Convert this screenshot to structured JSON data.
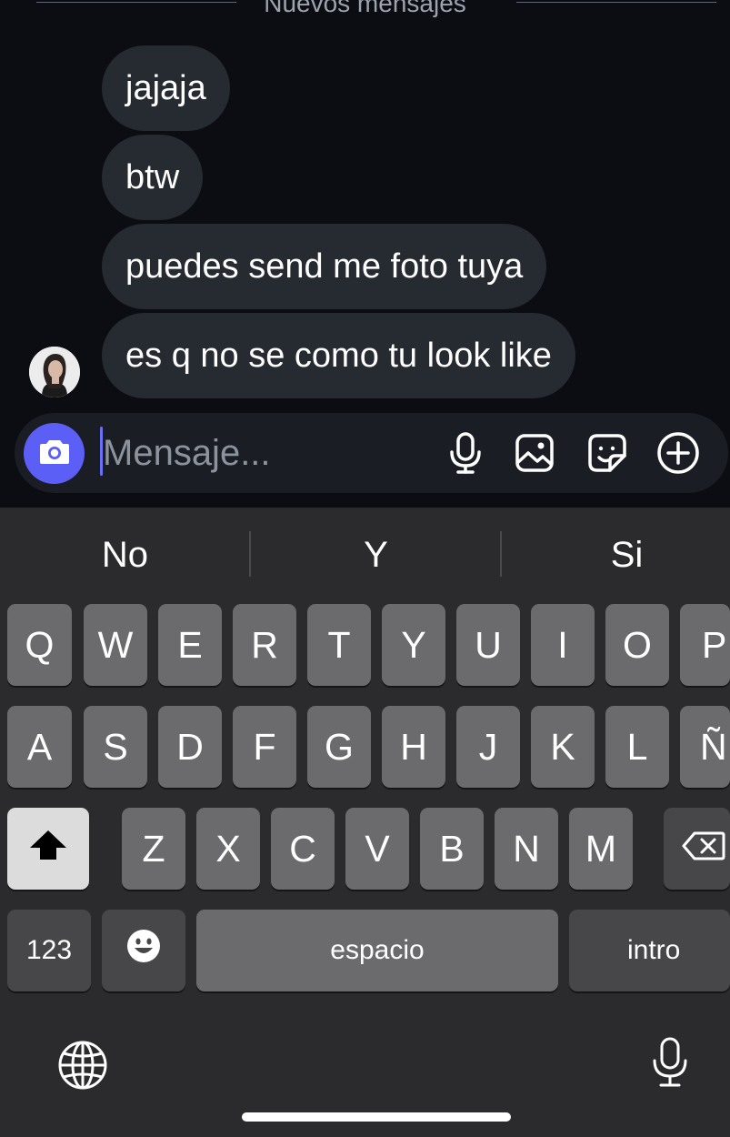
{
  "chat": {
    "divider": "Nuevos mensajes",
    "messages": [
      {
        "text": "jajaja"
      },
      {
        "text": "btw"
      },
      {
        "text": "puedes send me foto tuya"
      },
      {
        "text": "es q no se como tu look like"
      }
    ]
  },
  "composer": {
    "placeholder": "Mensaje...",
    "camera_icon": "camera-icon",
    "icons": [
      "microphone-icon",
      "gallery-icon",
      "sticker-icon",
      "add-icon"
    ],
    "accent": "#5b5ff5"
  },
  "keyboard": {
    "suggestions": [
      "No",
      "Y",
      "Si"
    ],
    "row1": [
      "Q",
      "W",
      "E",
      "R",
      "T",
      "Y",
      "U",
      "I",
      "O",
      "P"
    ],
    "row2": [
      "A",
      "S",
      "D",
      "F",
      "G",
      "H",
      "J",
      "K",
      "L",
      "Ñ"
    ],
    "row3": [
      "Z",
      "X",
      "C",
      "V",
      "B",
      "N",
      "M"
    ],
    "numbers_label": "123",
    "space_label": "espacio",
    "return_label": "intro",
    "shift_icon": "shift-icon",
    "delete_icon": "backspace-icon",
    "emoji_icon": "emoji-icon",
    "globe_icon": "globe-icon",
    "dictation_icon": "microphone-icon"
  }
}
